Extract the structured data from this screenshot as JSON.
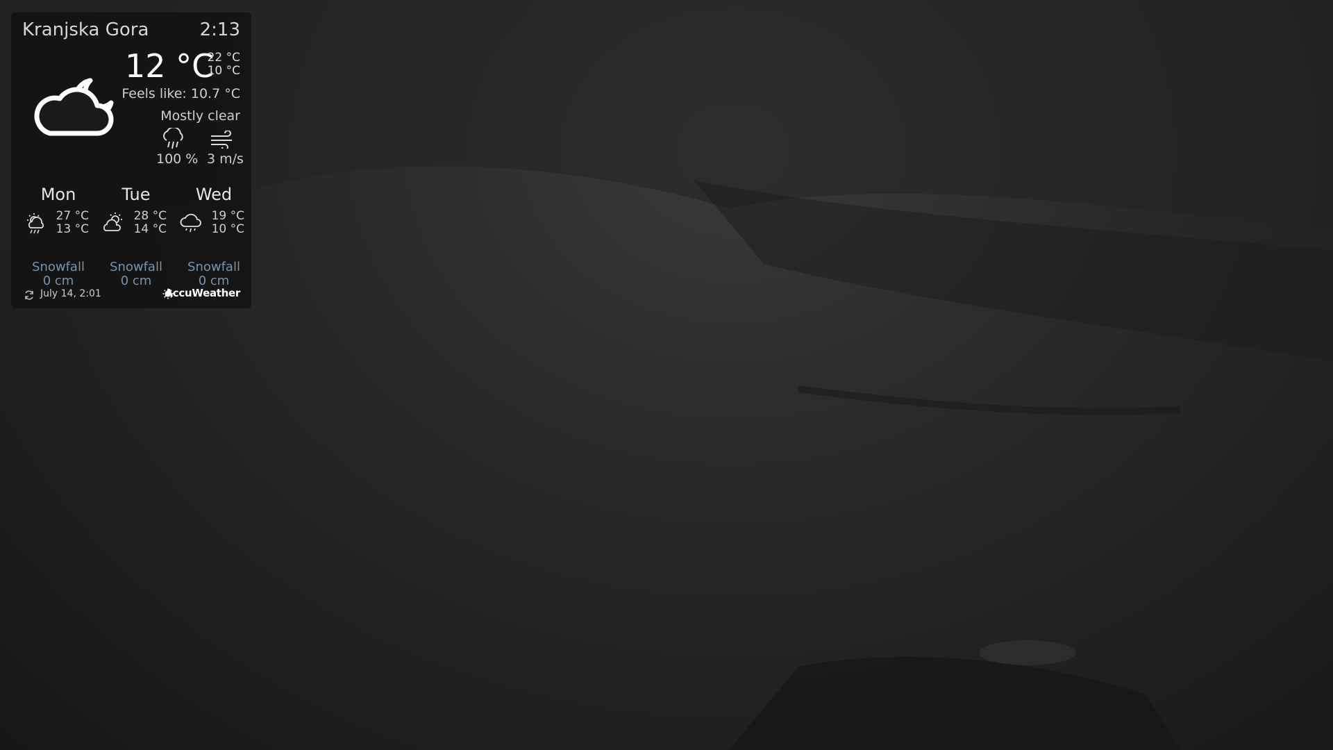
{
  "current": {
    "location": "Kranjska Gora",
    "time": "2:13",
    "temperature": "12 °C",
    "high": "22 °C",
    "low": "10 °C",
    "feels_like": "Feels like: 10.7 °C",
    "condition": "Mostly clear",
    "precipitation": "100 %",
    "wind": "3 m/s",
    "icon": "cloud-moon-icon"
  },
  "forecast": [
    {
      "day": "Mon",
      "high": "27 °C",
      "low": "13 °C",
      "snow_label": "Snowfall",
      "snow_value": "0 cm",
      "icon": "sun-rain-icon"
    },
    {
      "day": "Tue",
      "high": "28 °C",
      "low": "14 °C",
      "snow_label": "Snowfall",
      "snow_value": "0 cm",
      "icon": "partly-cloudy-icon"
    },
    {
      "day": "Wed",
      "high": "19 °C",
      "low": "10 °C",
      "snow_label": "Snowfall",
      "snow_value": "0 cm",
      "icon": "cloud-rain-icon"
    }
  ],
  "footer": {
    "updated": "July 14, 2:01",
    "provider": "AccuWeather"
  },
  "colors": {
    "snow_text": "#7b93a6",
    "panel_bg": "#0f0f0f"
  }
}
